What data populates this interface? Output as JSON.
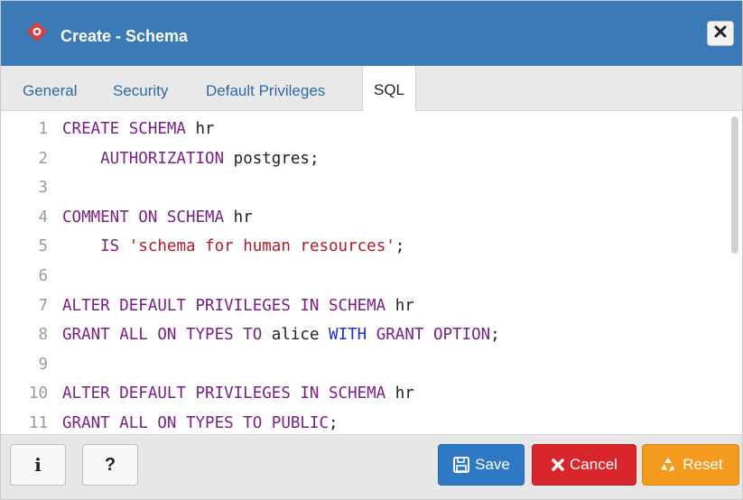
{
  "window": {
    "title": "Create - Schema",
    "close_icon": "close-icon"
  },
  "tabs": [
    {
      "label": "General",
      "active": false
    },
    {
      "label": "Security",
      "active": false
    },
    {
      "label": "Default Privileges",
      "active": false
    },
    {
      "label": "SQL",
      "active": true
    }
  ],
  "editor": {
    "lines": [
      {
        "number": "1",
        "tokens": [
          {
            "t": "CREATE SCHEMA",
            "c": "kw"
          },
          {
            "t": " hr",
            "c": "plain"
          }
        ]
      },
      {
        "number": "2",
        "tokens": [
          {
            "t": "    AUTHORIZATION",
            "c": "kw"
          },
          {
            "t": " postgres;",
            "c": "plain"
          }
        ]
      },
      {
        "number": "3",
        "tokens": []
      },
      {
        "number": "4",
        "tokens": [
          {
            "t": "COMMENT ON SCHEMA",
            "c": "kw"
          },
          {
            "t": " hr",
            "c": "plain"
          }
        ]
      },
      {
        "number": "5",
        "tokens": [
          {
            "t": "    IS ",
            "c": "kw"
          },
          {
            "t": "'schema for human resources'",
            "c": "str"
          },
          {
            "t": ";",
            "c": "plain"
          }
        ]
      },
      {
        "number": "6",
        "tokens": []
      },
      {
        "number": "7",
        "tokens": [
          {
            "t": "ALTER DEFAULT PRIVILEGES IN SCHEMA",
            "c": "kw"
          },
          {
            "t": " hr",
            "c": "plain"
          }
        ]
      },
      {
        "number": "8",
        "tokens": [
          {
            "t": "GRANT ALL ON TYPES TO",
            "c": "kw"
          },
          {
            "t": " alice ",
            "c": "plain"
          },
          {
            "t": "WITH",
            "c": "kw2"
          },
          {
            "t": " GRANT OPTION",
            "c": "kw"
          },
          {
            "t": ";",
            "c": "plain"
          }
        ]
      },
      {
        "number": "9",
        "tokens": []
      },
      {
        "number": "10",
        "tokens": [
          {
            "t": "ALTER DEFAULT PRIVILEGES IN SCHEMA",
            "c": "kw"
          },
          {
            "t": " hr",
            "c": "plain"
          }
        ]
      },
      {
        "number": "11",
        "tokens": [
          {
            "t": "GRANT ALL ON TYPES TO PUBLIC",
            "c": "kw"
          },
          {
            "t": ";",
            "c": "plain"
          }
        ]
      }
    ]
  },
  "footer": {
    "info_label": "i",
    "help_label": "?",
    "save_label": "Save",
    "cancel_label": "Cancel",
    "reset_label": "Reset"
  },
  "colors": {
    "titlebar": "#3b79b7",
    "keyword": "#7a1f86",
    "keyword_alt": "#1f2bd6",
    "string": "#b21b2a",
    "save": "#2f78c4",
    "cancel": "#d9262c",
    "reset": "#f39a1f"
  }
}
